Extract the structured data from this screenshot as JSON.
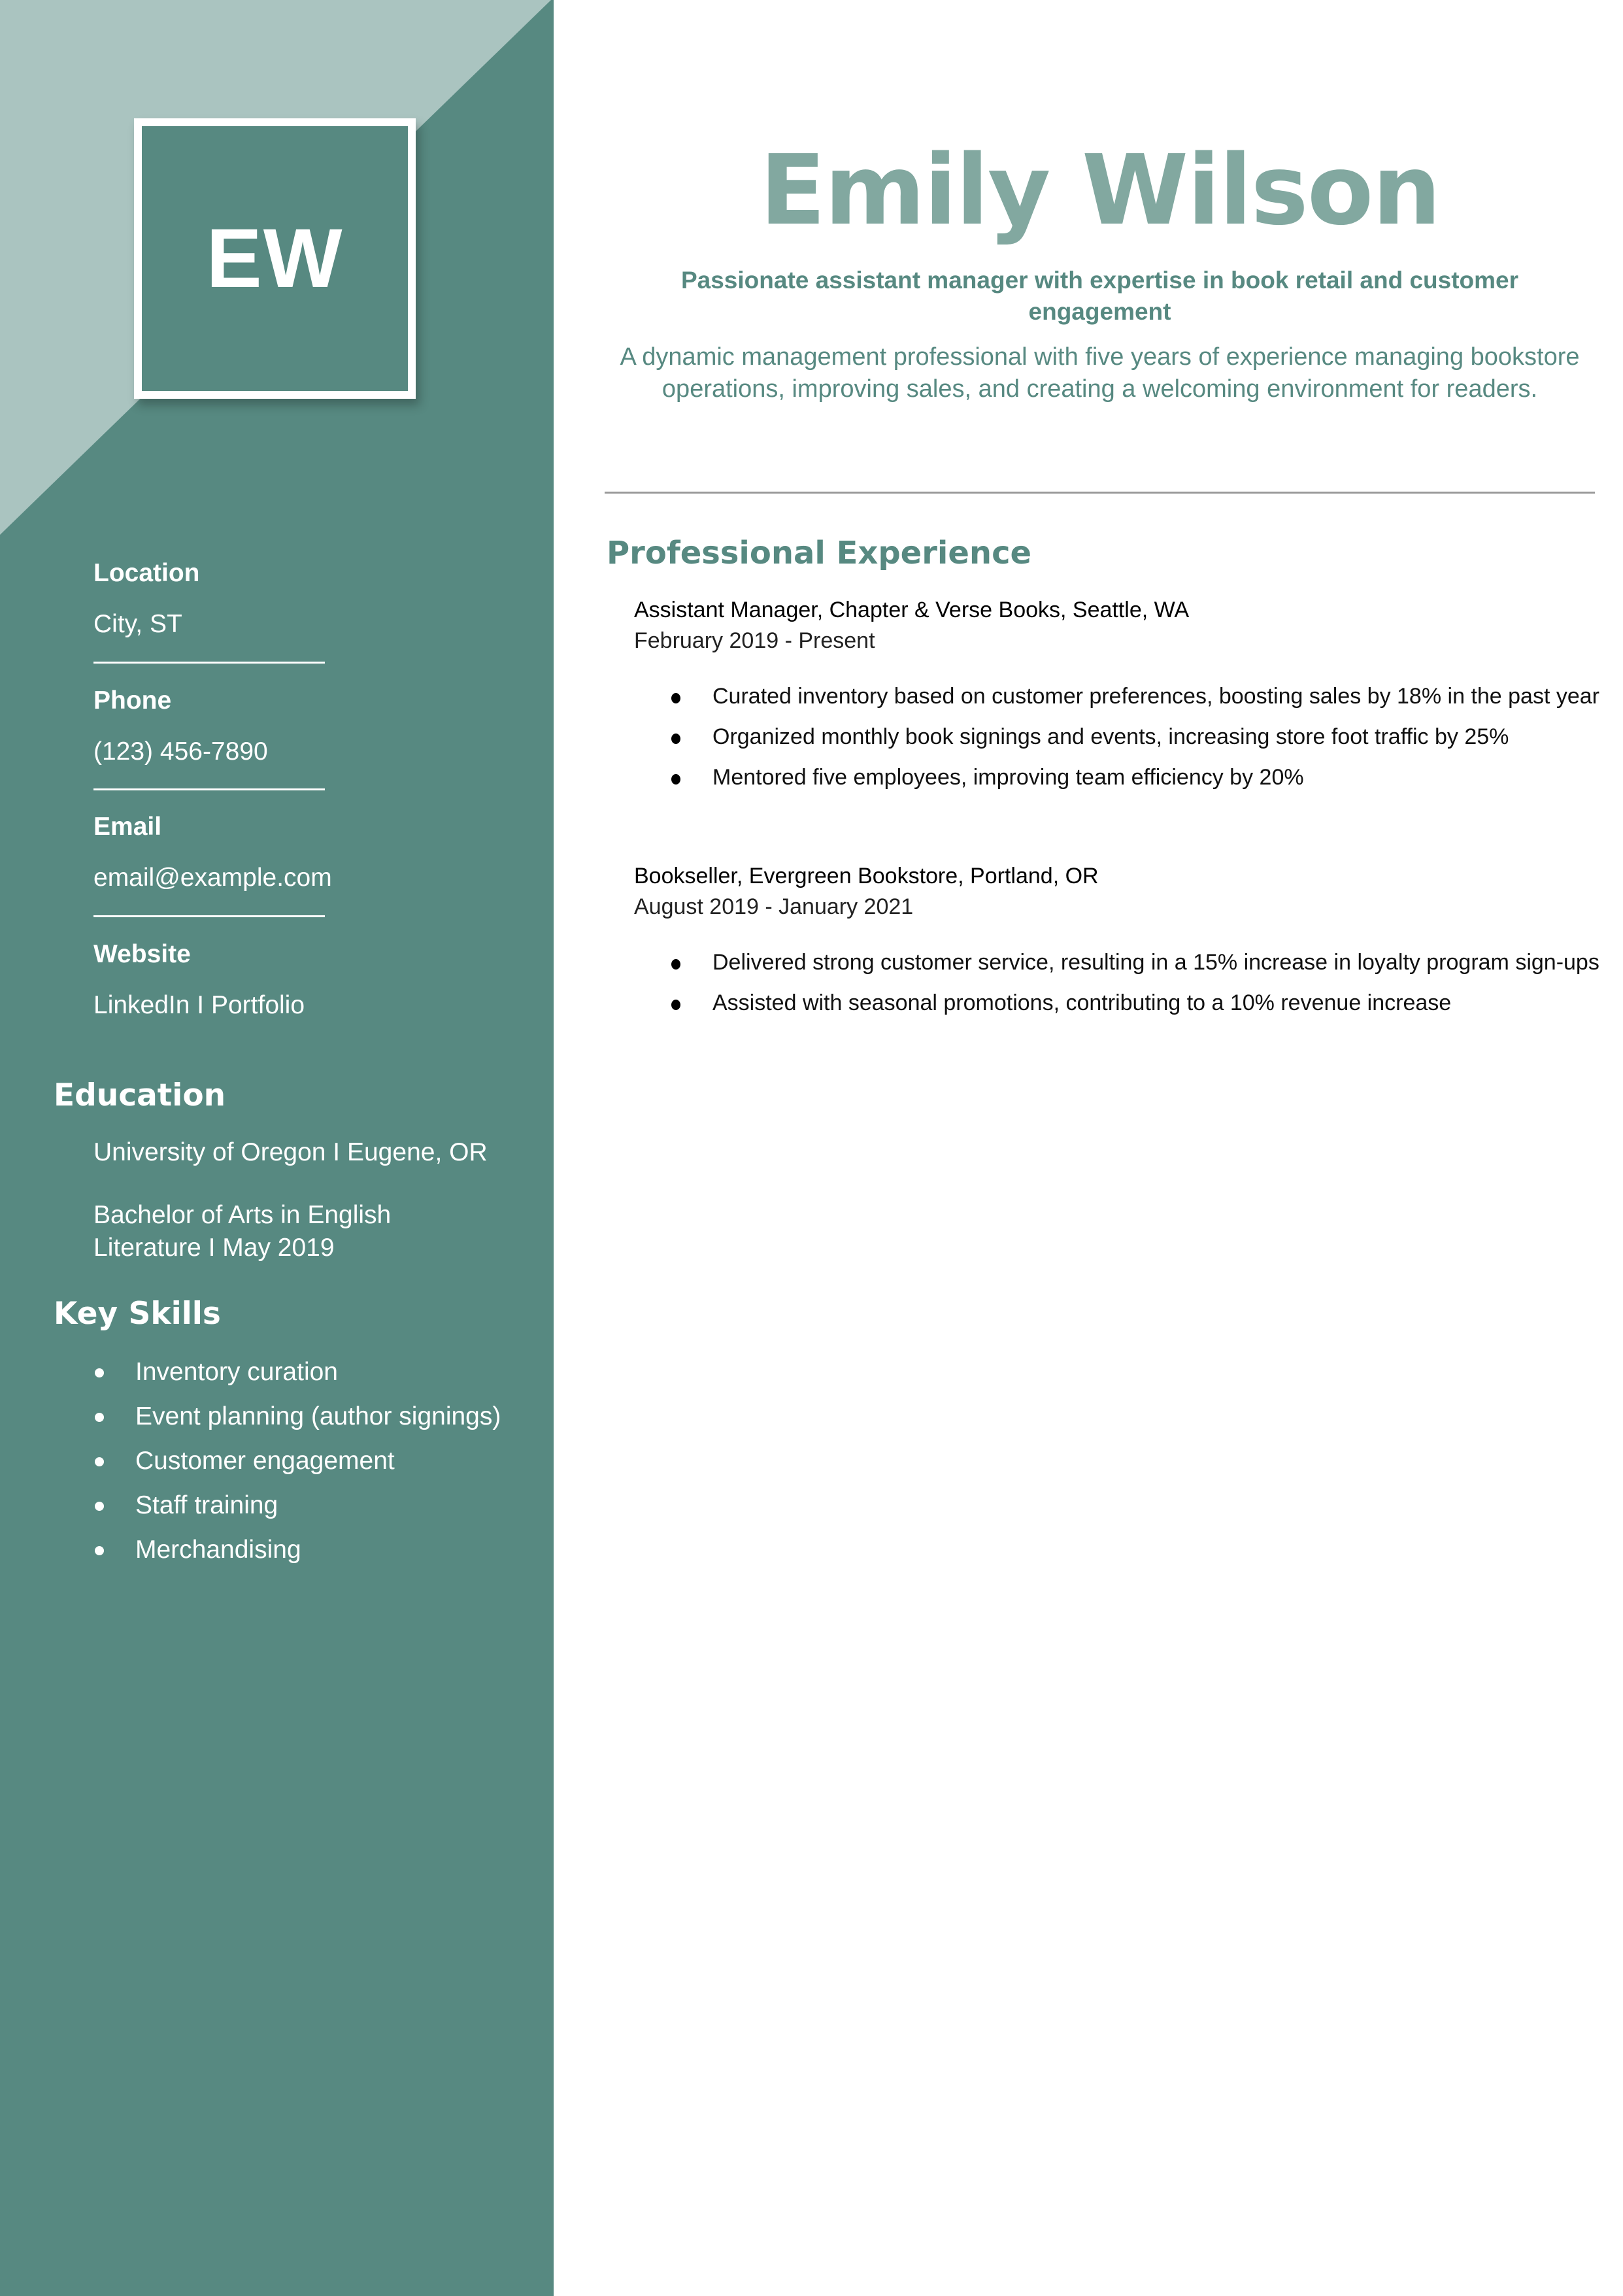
{
  "colors": {
    "sidebar": "#578981",
    "sidebar_light": "#aac4c0",
    "name": "#82a8a0",
    "accent": "#578981",
    "divider": "#999999"
  },
  "monogram": "EW",
  "header": {
    "name": "Emily Wilson",
    "tagline": "Passionate assistant manager with expertise in book retail and customer engagement",
    "summary": "A dynamic management professional with five years of experience managing bookstore operations, improving sales, and creating a welcoming environment for readers."
  },
  "contact": [
    {
      "label": "Location",
      "value": "City, ST"
    },
    {
      "label": "Phone",
      "value": "(123) 456-7890"
    },
    {
      "label": "Email",
      "value": "email@example.com"
    },
    {
      "label": "Website",
      "value": "LinkedIn I Portfolio"
    }
  ],
  "education": {
    "heading": "Education",
    "school": "University of Oregon I Eugene, OR",
    "degree_line1": "Bachelor of Arts in English",
    "degree_line2": "Literature I May 2019"
  },
  "skills": {
    "heading": "Key Skills",
    "items": [
      "Inventory curation",
      "Event planning (author signings)",
      "Customer engagement",
      "Staff training",
      "Merchandising"
    ]
  },
  "experience": {
    "heading": "Professional Experience",
    "jobs": [
      {
        "title": "Assistant Manager, Chapter & Verse Books, Seattle, WA",
        "dates": "February 2019 - Present",
        "bullets": [
          "Curated inventory based on customer preferences, boosting sales by 18% in the past year",
          "Organized monthly book signings and events, increasing store foot traffic by 25%",
          "Mentored five employees, improving team efficiency by 20%"
        ]
      },
      {
        "title": "Bookseller, Evergreen Bookstore, Portland, OR",
        "dates": "August 2019 - January 2021",
        "bullets": [
          "Delivered strong customer service, resulting in a 15% increase in loyalty program sign-ups",
          "Assisted with seasonal promotions, contributing to a 10% revenue increase"
        ]
      }
    ]
  }
}
